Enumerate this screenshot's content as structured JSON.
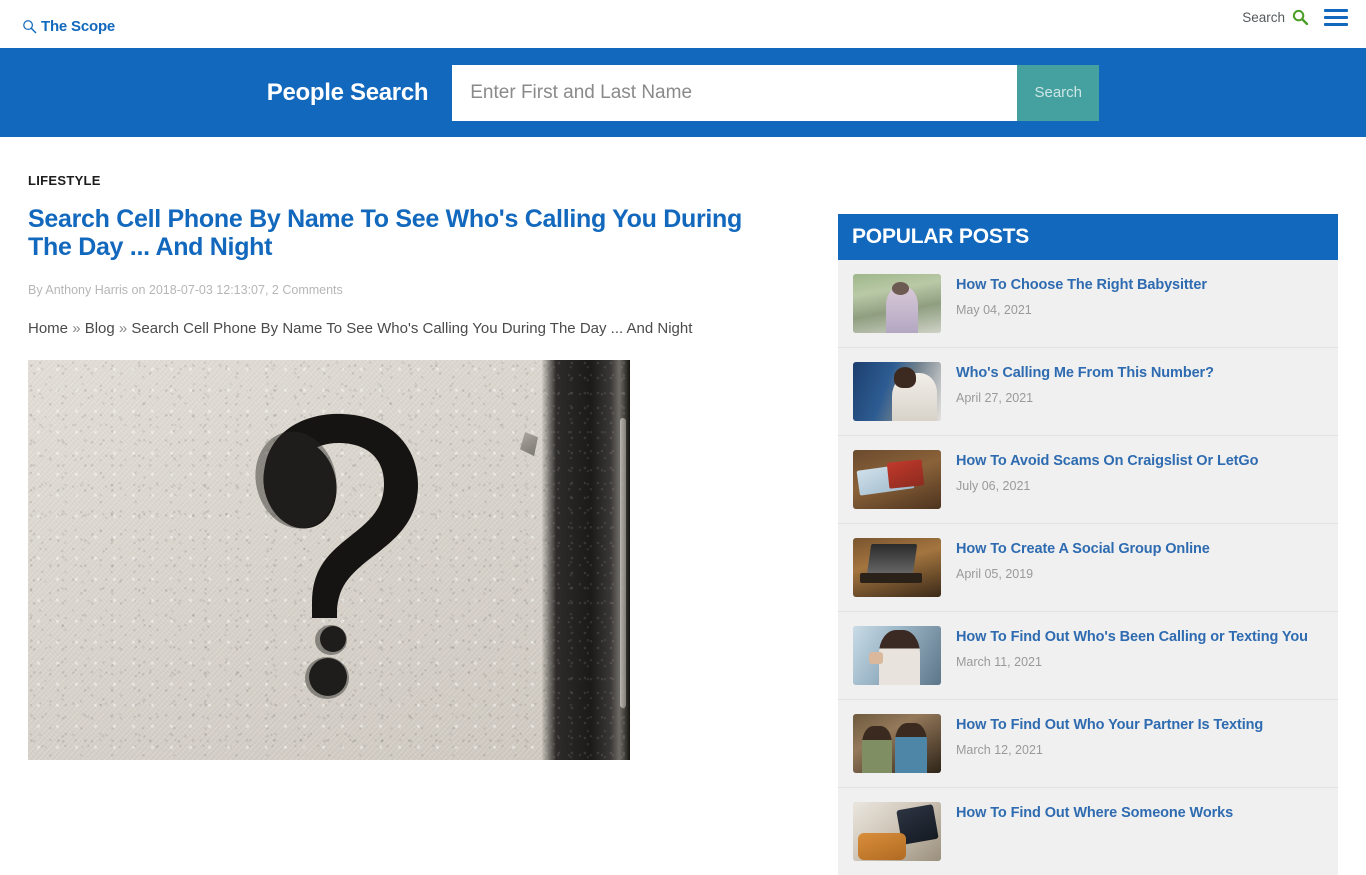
{
  "site": {
    "logo_text": "The Scope",
    "logo_icon": "magnifier-icon"
  },
  "topbar": {
    "search_label": "Search",
    "search_icon": "search-icon-green",
    "menu_icon": "hamburger-menu-icon",
    "accent_blue": "#1268bd",
    "search_icon_color": "#4a9e28"
  },
  "hero": {
    "title": "People Search",
    "input_value": "",
    "input_placeholder": "Enter First and Last Name",
    "button_label": "Search",
    "background": "#1268bd",
    "button_background": "#45a0a0"
  },
  "article": {
    "category": "LIFESTYLE",
    "headline": "Search Cell Phone By Name To See Who's Calling You During The Day ... And Night",
    "byline": "By Anthony Harris on 2018-07-03 12:13:07, 2 Comments",
    "breadcrumb": {
      "home": "Home",
      "blog": "Blog",
      "separator": "»",
      "current": "Search Cell Phone By Name To See Who's Calling You During The Day ... And Night"
    },
    "image_alt": "spray-painted question mark on concrete wall"
  },
  "sidebar": {
    "heading": "POPULAR POSTS",
    "posts": [
      {
        "title": "How To Choose The Right Babysitter",
        "date": "May 04, 2021",
        "thumb": "th1"
      },
      {
        "title": "Who's Calling Me From This Number?",
        "date": "April 27, 2021",
        "thumb": "th2"
      },
      {
        "title": "How To Avoid Scams On Craigslist Or LetGo",
        "date": "July 06, 2021",
        "thumb": "th3"
      },
      {
        "title": "How To Create A Social Group Online",
        "date": "April 05, 2019",
        "thumb": "th4"
      },
      {
        "title": "How To Find Out Who's Been Calling or Texting You",
        "date": "March 11, 2021",
        "thumb": "th5"
      },
      {
        "title": "How To Find Out Who Your Partner Is Texting",
        "date": "March 12, 2021",
        "thumb": "th6"
      },
      {
        "title": "How To Find Out Where Someone Works",
        "date": "",
        "thumb": "th7"
      }
    ]
  }
}
